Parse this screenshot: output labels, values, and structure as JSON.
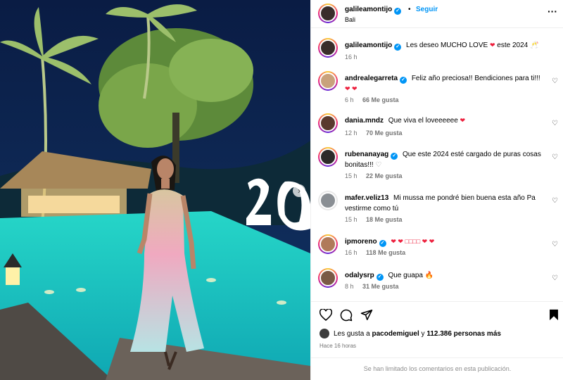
{
  "post": {
    "username": "galileamontijo",
    "follow_label": "Seguir",
    "separator": "•",
    "location": "Bali",
    "more_label": "···",
    "caption_text": "Les deseo MUCHO LOVE",
    "caption_suffix": "este 2024",
    "caption_time": "16 h"
  },
  "comments": [
    {
      "user": "andrealegarreta",
      "verified": true,
      "text": "Feliz año preciosa!! Bendiciones para ti!!!",
      "emoji": "❤ ❤",
      "time": "6 h",
      "likes": "66 Me gusta"
    },
    {
      "user": "dania.mndz",
      "verified": false,
      "text": "Que viva el loveeeeee",
      "emoji": "❤",
      "time": "12 h",
      "likes": "70 Me gusta"
    },
    {
      "user": "rubenanayag",
      "verified": true,
      "text": "Que este 2024 esté cargado de puras cosas bonitas!!!",
      "emoji": "♡",
      "time": "15 h",
      "likes": "22 Me gusta"
    },
    {
      "user": "mafer.veliz13",
      "verified": false,
      "text": "Mi mussa me pondré bien buena esta año Pa vestirme como tú",
      "emoji": "",
      "time": "15 h",
      "likes": "18 Me gusta"
    },
    {
      "user": "ipmoreno",
      "verified": true,
      "text": "❤ ❤ □□□□ ❤ ❤",
      "emoji": "",
      "time": "16 h",
      "likes": "118 Me gusta"
    },
    {
      "user": "odalysrp",
      "verified": true,
      "text": "Que guapa",
      "emoji": "🔥",
      "time": "8 h",
      "likes": "31 Me gusta"
    }
  ],
  "footer": {
    "liked_prefix": "Les gusta a",
    "liked_user": "pacodemiguel",
    "liked_and": "y",
    "liked_count": "112.386 personas más",
    "time_ago": "Hace 16 horas",
    "limited_text": "Se han limitado los comentarios en esta publicación."
  },
  "colors": {
    "accent": "#0095f6",
    "heart": "#ed1c3a",
    "muted": "#737373"
  },
  "icons": [
    "heart-icon",
    "comment-icon",
    "share-icon",
    "bookmark-icon",
    "verified-icon",
    "more-icon",
    "chevron-right-icon"
  ]
}
